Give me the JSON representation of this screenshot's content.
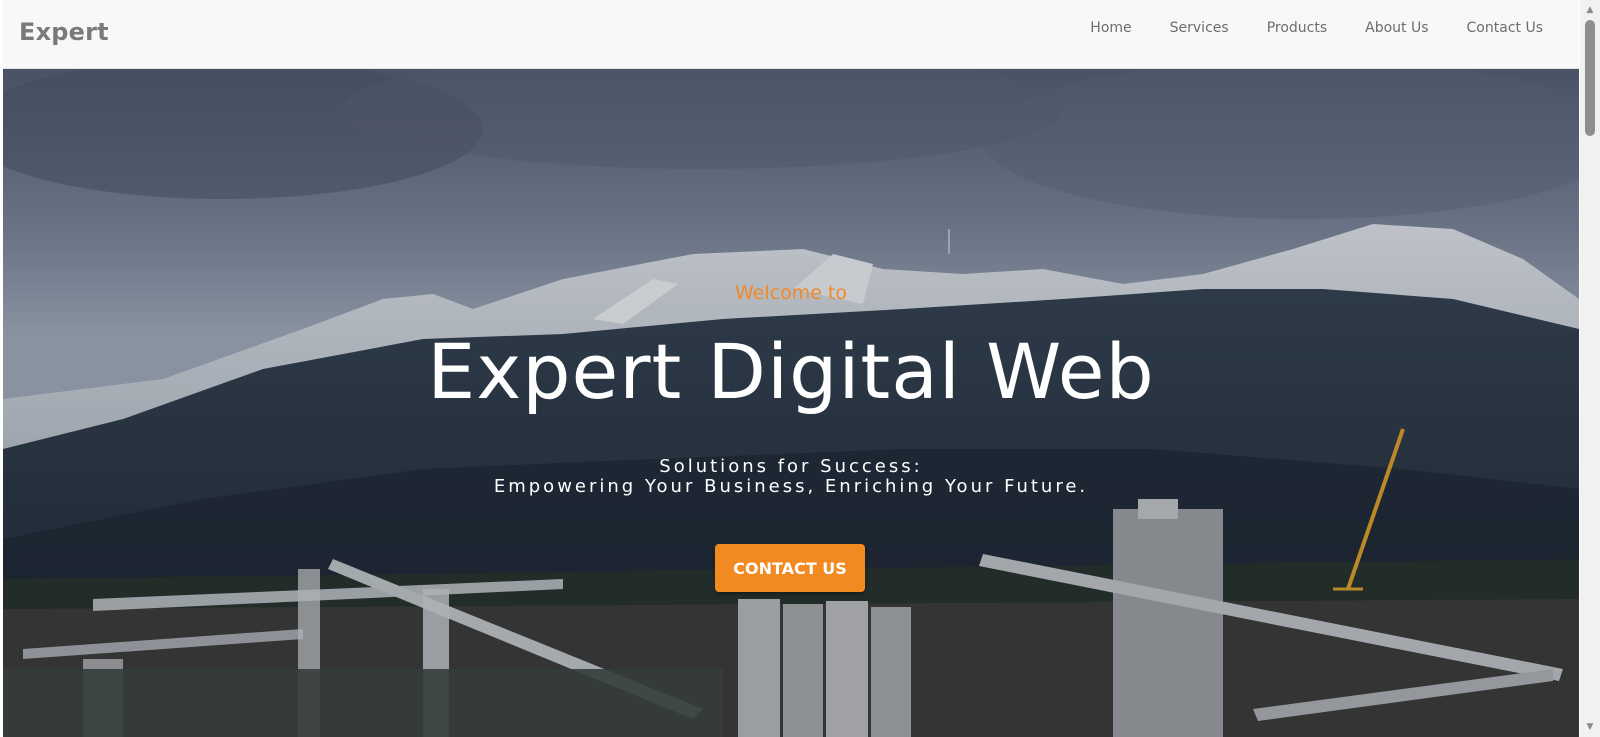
{
  "navbar": {
    "brand": "Expert",
    "links": [
      "Home",
      "Services",
      "Products",
      "About Us",
      "Contact Us"
    ]
  },
  "hero": {
    "welcome": "Welcome to",
    "title": "Expert Digital Web",
    "tagline_line1": "Solutions for Success:",
    "tagline_line2": "Empowering Your Business, Enriching Your Future.",
    "cta_label": "CONTACT US",
    "background_image": "mountains-industrial-harbor"
  },
  "colors": {
    "accent": "#f28a22",
    "welcome_text": "#f0892a",
    "navbar_bg": "#f8f8f8",
    "brand_text": "#7a7a7a"
  },
  "scrollbar": {
    "up_icon": "scroll-up-arrow-icon",
    "down_icon": "scroll-down-arrow-icon"
  }
}
